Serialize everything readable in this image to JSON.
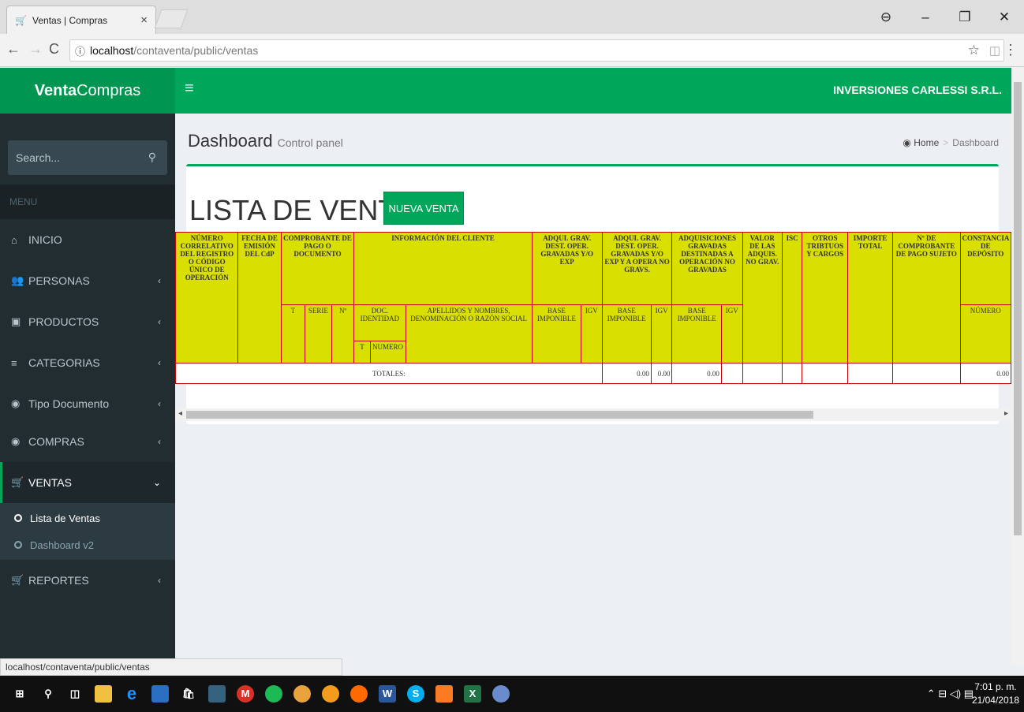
{
  "browser": {
    "tab_title": "Ventas | Compras",
    "tab_close": "×",
    "url_host": "localhost",
    "url_path": "/contaventa/public/ventas",
    "status_url": "localhost/contaventa/public/ventas"
  },
  "header": {
    "logo_bold": "Venta",
    "logo_rest": "Compras",
    "company": "INVERSIONES CARLESSI S.R.L."
  },
  "sidebar": {
    "search_placeholder": "Search...",
    "menu_label": "MENU",
    "items": [
      {
        "label": "INICIO",
        "icon": "home-icon"
      },
      {
        "label": "PERSONAS",
        "icon": "users-icon"
      },
      {
        "label": "PRODUCTOS",
        "icon": "gift-icon"
      },
      {
        "label": "CATEGORIAS",
        "icon": "bars-icon"
      },
      {
        "label": "Tipo Documento",
        "icon": "dashboard-icon"
      },
      {
        "label": "COMPRAS",
        "icon": "dashboard-icon"
      },
      {
        "label": "VENTAS",
        "icon": "cart-icon"
      },
      {
        "label": "REPORTES",
        "icon": "cart-icon"
      }
    ],
    "sub_items": [
      "Lista de Ventas",
      "Dashboard v2"
    ]
  },
  "page": {
    "title": "Dashboard",
    "subtitle": "Control panel",
    "breadcrumb_home": "Home",
    "breadcrumb_current": "Dashboard",
    "list_title": "LISTA DE VENTAS:",
    "new_button": "NUEVA VENTA"
  },
  "table": {
    "h_numero": "NÚMERO CORRELATIVO DEL REGISTRO O CÓDIGO ÚNICO DE OPERACIÓN",
    "h_fecha": "FECHA DE EMISIÓN DEL CdP",
    "h_comprobante": "COMPROBANTE DE PAGO O DOCUMENTO",
    "h_cliente": "INFORMACIÓN DEL CLIENTE",
    "h_adq1": "ADQUI. GRAV. DEST. OPER. GRAVADAS Y/O EXP",
    "h_adq2": "ADQUI. GRAV. DEST. OPER. GRAVADAS Y/O EXP Y A OPERA NO GRAVS.",
    "h_adq3": "ADQUISICIONES GRAVADAS DESTINADAS A OPERACIÓN NO GRAVADAS",
    "h_valor": "VALOR DE LAS ADQUIS. NO GRAV.",
    "h_isc": "ISC",
    "h_otros": "OTROS TRIBTUOS Y CARGOS",
    "h_importe": "IMPORTE TOTAL",
    "h_ncomp": "Nº DE COMPROBANTE DE PAGO SUJETO",
    "h_const": "CONSTANCIA DE DEPÓSITO",
    "t": "T",
    "serie": "SERIE",
    "n": "Nº",
    "doc": "DOC. IDENTIDAD",
    "apellidos": "APELLIDOS Y NOMBRES, DENOMINACIÓN O RAZÓN SOCIAL",
    "base": "BASE IMPONIBLE",
    "igv": "IGV",
    "numero": "NÚMERO",
    "t2": "T",
    "numero2": "NUMERO",
    "totales": "TOTALES:",
    "tot_base1": "0.00",
    "tot_igv1": "0.00",
    "tot_base2": "0.00",
    "tot_importe": "0.00"
  },
  "taskbar": {
    "time": "7:01 p. m.",
    "date": "21/04/2018"
  }
}
